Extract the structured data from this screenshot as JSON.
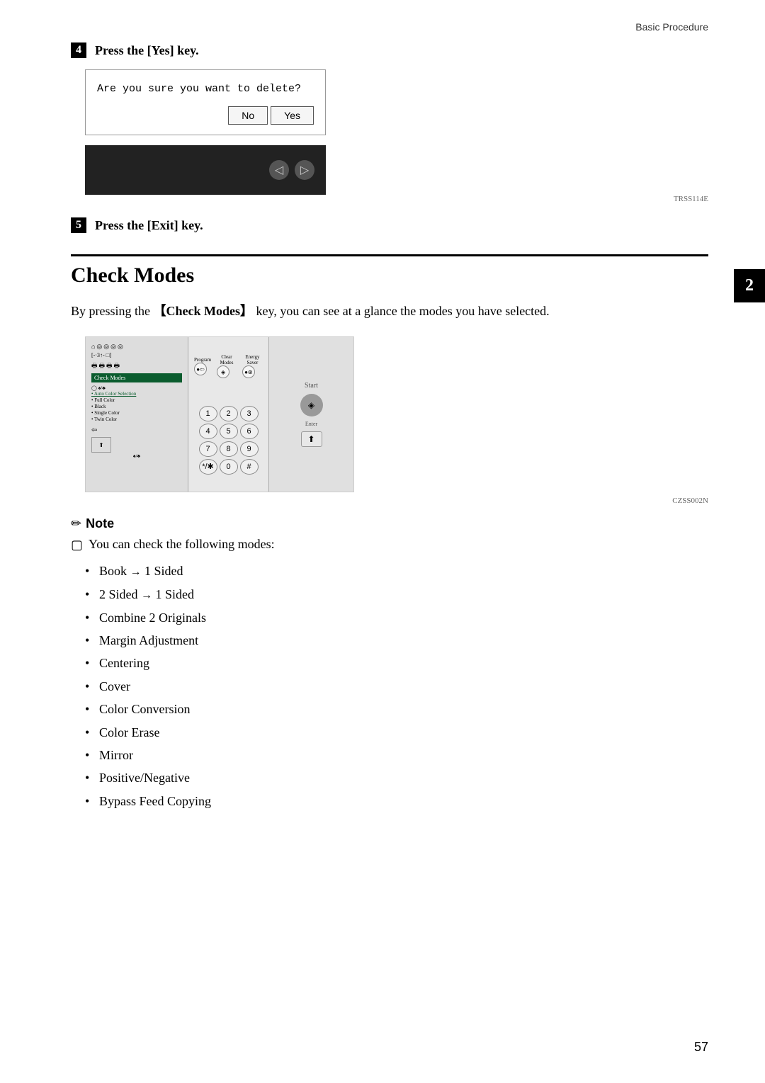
{
  "header": {
    "label": "Basic Procedure"
  },
  "step4": {
    "number": "4",
    "text": "Press the [Yes] key.",
    "brackets": "[Yes]",
    "dialog": {
      "message": "Are you sure you want to delete?",
      "no_button": "No",
      "yes_button": "Yes"
    },
    "image_label": "TRSS114E"
  },
  "step5": {
    "number": "5",
    "text": "Press the [Exit] key.",
    "brackets": "[Exit]"
  },
  "check_modes": {
    "heading": "Check Modes",
    "body_part1": "By pressing the ",
    "body_key": "【Check Modes】",
    "body_part2": " key, you can see at a glance the modes you have selected.",
    "image_label": "CZSS002N",
    "note": {
      "title": "Note",
      "checkbox_text": "You can check the following modes:",
      "items": [
        "Book → 1 Sided",
        "2 Sided → 1 Sided",
        "Combine 2 Originals",
        "Margin Adjustment",
        "Centering",
        "Cover",
        "Color Conversion",
        "Color Erase",
        "Mirror",
        "Positive/Negative",
        "Bypass Feed Copying"
      ]
    }
  },
  "right_tab": {
    "number": "2"
  },
  "page_number": "57"
}
